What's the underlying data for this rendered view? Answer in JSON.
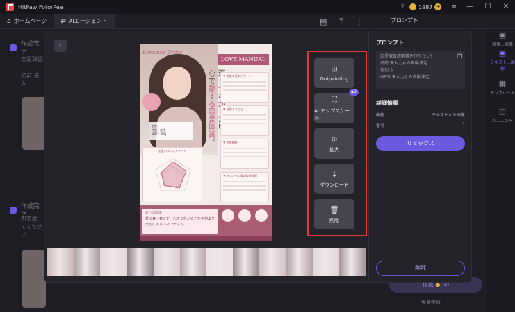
{
  "window": {
    "app_title": "HitPaw FotorPea",
    "coin_count": "1987"
  },
  "nav": {
    "home": "ホームページ",
    "agent": "AIエージェント"
  },
  "background": {
    "row1_title": "作成完了",
    "row1_sub_a": "恋愛取扱",
    "row1_sub_b": "名前:未入",
    "row2_title": "作成完了",
    "row2_sub_a": "AI恋愛",
    "row2_sub_b": "てください",
    "right_prompt_tab": "プロンプト",
    "right_items": [
      "画像...画像",
      "テキスト...画像",
      "テンプレート",
      "AI...エント"
    ],
    "create_label": "作成",
    "create_cost": "50",
    "free_label": "免費学習"
  },
  "poster": {
    "script_title": "Romantic Types",
    "badge": "LOVE MANUAL",
    "vertical_line1": "深くつながりたい、",
    "vertical_line2_pre": "心で",
    "vertical_line2_pink": "愛する恋愛体質",
    "vertical_line2_post": "。",
    "info_lines": [
      "名前：",
      "性別：女性",
      "MBTI：INFJ"
    ],
    "cards": [
      "恋愛の基本パターン",
      "注意すること",
      "恋愛相性",
      "あなたへの愛の取扱説明"
    ],
    "chart_title": "恋愛バランスチャート",
    "bottom_label": "おとなな恋愛",
    "bottom_text": "愛に真っ直ぐで、心でつながることを何より大切にするロマンチスト。"
  },
  "tools": {
    "outpainting": "Outpainting",
    "upscale": "AI アップスケール",
    "upscale_badge": "2",
    "zoom": "拡大",
    "download": "ダウンロード",
    "delete": "削除"
  },
  "info": {
    "prompt_heading": "プロンプト",
    "prompt_lines": [
      "恋愛取扱説明書を作りたい！",
      "名前:未入力なら自動決定",
      "性別:女",
      "MBTI:未入力なら自動決定"
    ],
    "details_heading": "詳細情報",
    "function_label": "機能",
    "function_value": "テキストから画像",
    "number_label": "番号",
    "number_value": "1",
    "remix": "リミックス",
    "delete": "削除"
  },
  "thumb_colors": [
    "#c8b6b6",
    "#a99b9f",
    "#e3d8da",
    "#8d7f86",
    "#d9cdd0",
    "#b8a7ac",
    "#eae2e3",
    "#9a8a90",
    "#cfc0c4",
    "#b3a2a8",
    "#e1d6d8",
    "#a39398"
  ]
}
